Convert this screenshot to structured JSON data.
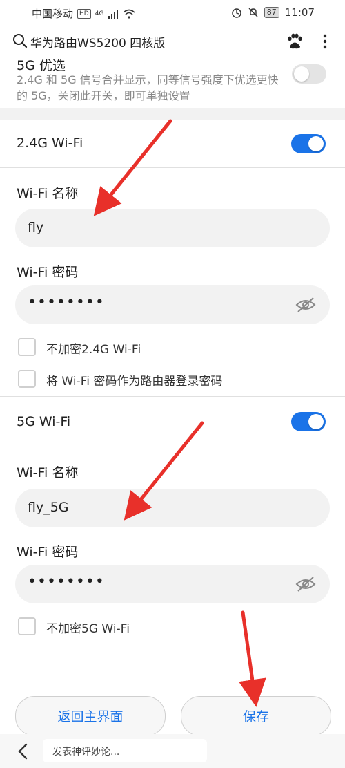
{
  "status_bar": {
    "carrier": "中国移动",
    "hd": "HD",
    "signal": "4G",
    "battery": "87",
    "time": "11:07"
  },
  "header": {
    "title": "华为路由WS5200 四核版"
  },
  "smart_5g": {
    "title": "5G 优选",
    "description": "2.4G 和 5G 信号合并显示，同等信号强度下优选更快的 5G，关闭此开关，即可单独设置",
    "enabled": false
  },
  "wifi_24": {
    "section_title": "2.4G Wi-Fi",
    "enabled": true,
    "name_label": "Wi-Fi 名称",
    "name_value": "fly",
    "password_label": "Wi-Fi 密码",
    "password_value": "••••••••",
    "no_encrypt_label": "不加密2.4G Wi-Fi",
    "use_as_admin_label": "将 Wi-Fi 密码作为路由器登录密码"
  },
  "wifi_5": {
    "section_title": "5G Wi-Fi",
    "enabled": true,
    "name_label": "Wi-Fi 名称",
    "name_value": "fly_5G",
    "password_label": "Wi-Fi 密码",
    "password_value": "••••••••",
    "no_encrypt_label": "不加密5G Wi-Fi"
  },
  "buttons": {
    "back_home": "返回主界面",
    "save": "保存"
  },
  "comment_bar": {
    "placeholder": "发表神评妙论..."
  },
  "colors": {
    "accent": "#1a73e8",
    "arrow": "#e8302a"
  }
}
